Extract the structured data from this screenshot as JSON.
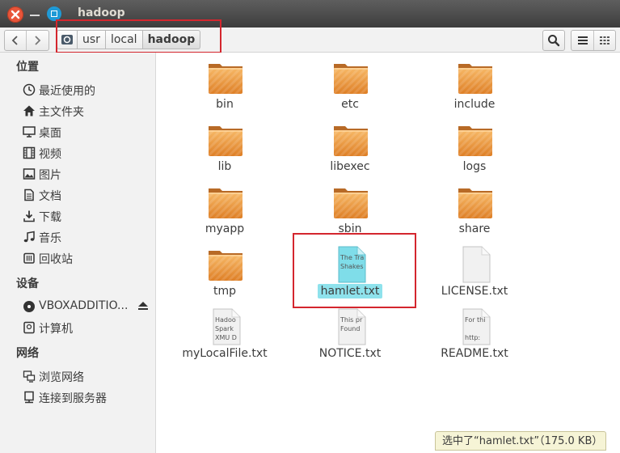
{
  "window": {
    "title": "hadoop"
  },
  "pathbar": {
    "crumbs": [
      "usr",
      "local",
      "hadoop"
    ]
  },
  "sidebar": {
    "sections": [
      {
        "title": "位置",
        "items": [
          "最近使用的",
          "主文件夹",
          "桌面",
          "视频",
          "图片",
          "文档",
          "下载",
          "音乐",
          "回收站"
        ]
      },
      {
        "title": "设备",
        "items": [
          "VBOXADDITIO...",
          "计算机"
        ]
      },
      {
        "title": "网络",
        "items": [
          "浏览网络",
          "连接到服务器"
        ]
      }
    ]
  },
  "files": [
    {
      "name": "bin",
      "type": "folder"
    },
    {
      "name": "etc",
      "type": "folder"
    },
    {
      "name": "include",
      "type": "folder"
    },
    {
      "name": "lib",
      "type": "folder"
    },
    {
      "name": "libexec",
      "type": "folder"
    },
    {
      "name": "logs",
      "type": "folder"
    },
    {
      "name": "myapp",
      "type": "folder"
    },
    {
      "name": "sbin",
      "type": "folder"
    },
    {
      "name": "share",
      "type": "folder"
    },
    {
      "name": "tmp",
      "type": "folder"
    },
    {
      "name": "hamlet.txt",
      "type": "text",
      "selected": true,
      "preview": [
        "The Tra",
        "Shakes"
      ]
    },
    {
      "name": "LICENSE.txt",
      "type": "text",
      "preview": []
    },
    {
      "name": "myLocalFile.txt",
      "type": "text",
      "preview": [
        "Hadoo",
        "Spark",
        "XMU D"
      ]
    },
    {
      "name": "NOTICE.txt",
      "type": "text",
      "preview": [
        "This pr",
        "Found"
      ]
    },
    {
      "name": "README.txt",
      "type": "text",
      "preview": [
        "For thi",
        "",
        "http:"
      ]
    }
  ],
  "status": {
    "text": "选中了“hamlet.txt”（175.0 KB）"
  },
  "colors": {
    "selection": "#8ee2ec",
    "annotation": "#d4262e",
    "folder": "#f0a040",
    "accent": "#1f9ad6"
  }
}
